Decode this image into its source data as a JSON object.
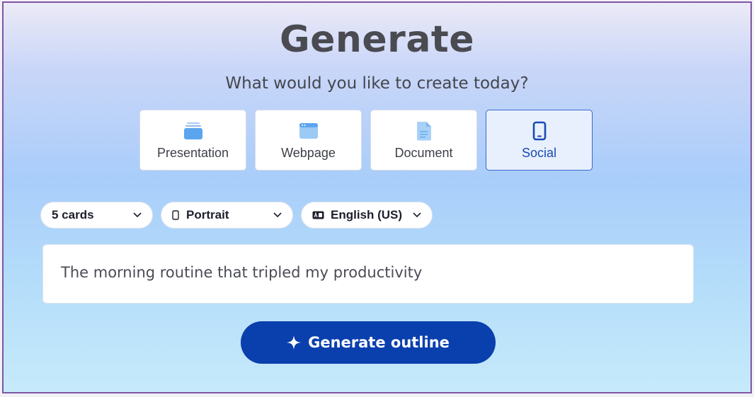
{
  "header": {
    "title": "Generate",
    "subtitle": "What would you like to create today?"
  },
  "content_types": [
    {
      "label": "Presentation",
      "icon": "presentation-icon",
      "selected": false
    },
    {
      "label": "Webpage",
      "icon": "webpage-icon",
      "selected": false
    },
    {
      "label": "Document",
      "icon": "document-icon",
      "selected": false
    },
    {
      "label": "Social",
      "icon": "phone-icon",
      "selected": true
    }
  ],
  "options": {
    "cards": "5 cards",
    "orientation": "Portrait",
    "language": "English (US)"
  },
  "prompt": {
    "value": "The morning routine that tripled my productivity"
  },
  "generate_button": {
    "label": "Generate outline"
  },
  "colors": {
    "accent": "#0a3fae",
    "selected_card_bg": "#e9f0fd",
    "selected_card_border": "#3968cf",
    "frame_border": "#7d56a3"
  }
}
